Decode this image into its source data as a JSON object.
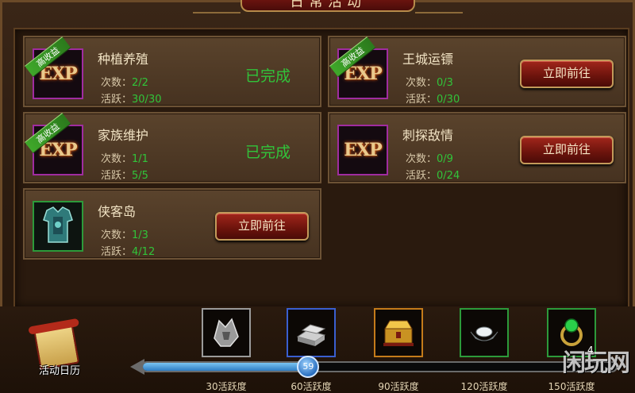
{
  "title": "日常活动",
  "activities": [
    {
      "name": "种植养殖",
      "count_label": "次数：",
      "count": "2/2",
      "active_label": "活跃：",
      "active": "30/30",
      "badge": "高收益",
      "icon": "exp-icon",
      "status": "已完成"
    },
    {
      "name": "王城运镖",
      "count_label": "次数：",
      "count": "0/3",
      "active_label": "活跃：",
      "active": "0/30",
      "badge": "高收益",
      "icon": "exp-icon",
      "button": "立即前往"
    },
    {
      "name": "家族维护",
      "count_label": "次数：",
      "count": "1/1",
      "active_label": "活跃：",
      "active": "5/5",
      "badge": "高收益",
      "icon": "exp-icon",
      "status": "已完成"
    },
    {
      "name": "刺探敌情",
      "count_label": "次数：",
      "count": "0/9",
      "active_label": "活跃：",
      "active": "0/24",
      "icon": "exp-icon",
      "button": "立即前往"
    },
    {
      "name": "侠客岛",
      "count_label": "次数：",
      "count": "1/3",
      "active_label": "活跃：",
      "active": "4/12",
      "icon": "armor-icon",
      "button": "立即前往"
    }
  ],
  "exp_text": "EXP",
  "calendar_label": "活动日历",
  "progress": {
    "value": "59",
    "max": 150
  },
  "rewards": [
    {
      "label": "30活跃度",
      "icon": "crest-icon"
    },
    {
      "label": "60活跃度",
      "icon": "silver-bars-icon"
    },
    {
      "label": "90活跃度",
      "icon": "treasure-chest-icon"
    },
    {
      "label": "120活跃度",
      "icon": "silver-ingot-icon"
    },
    {
      "label": "150活跃度",
      "icon": "jade-ring-icon"
    }
  ],
  "reward_extra": "4",
  "watermark": "闲玩网"
}
